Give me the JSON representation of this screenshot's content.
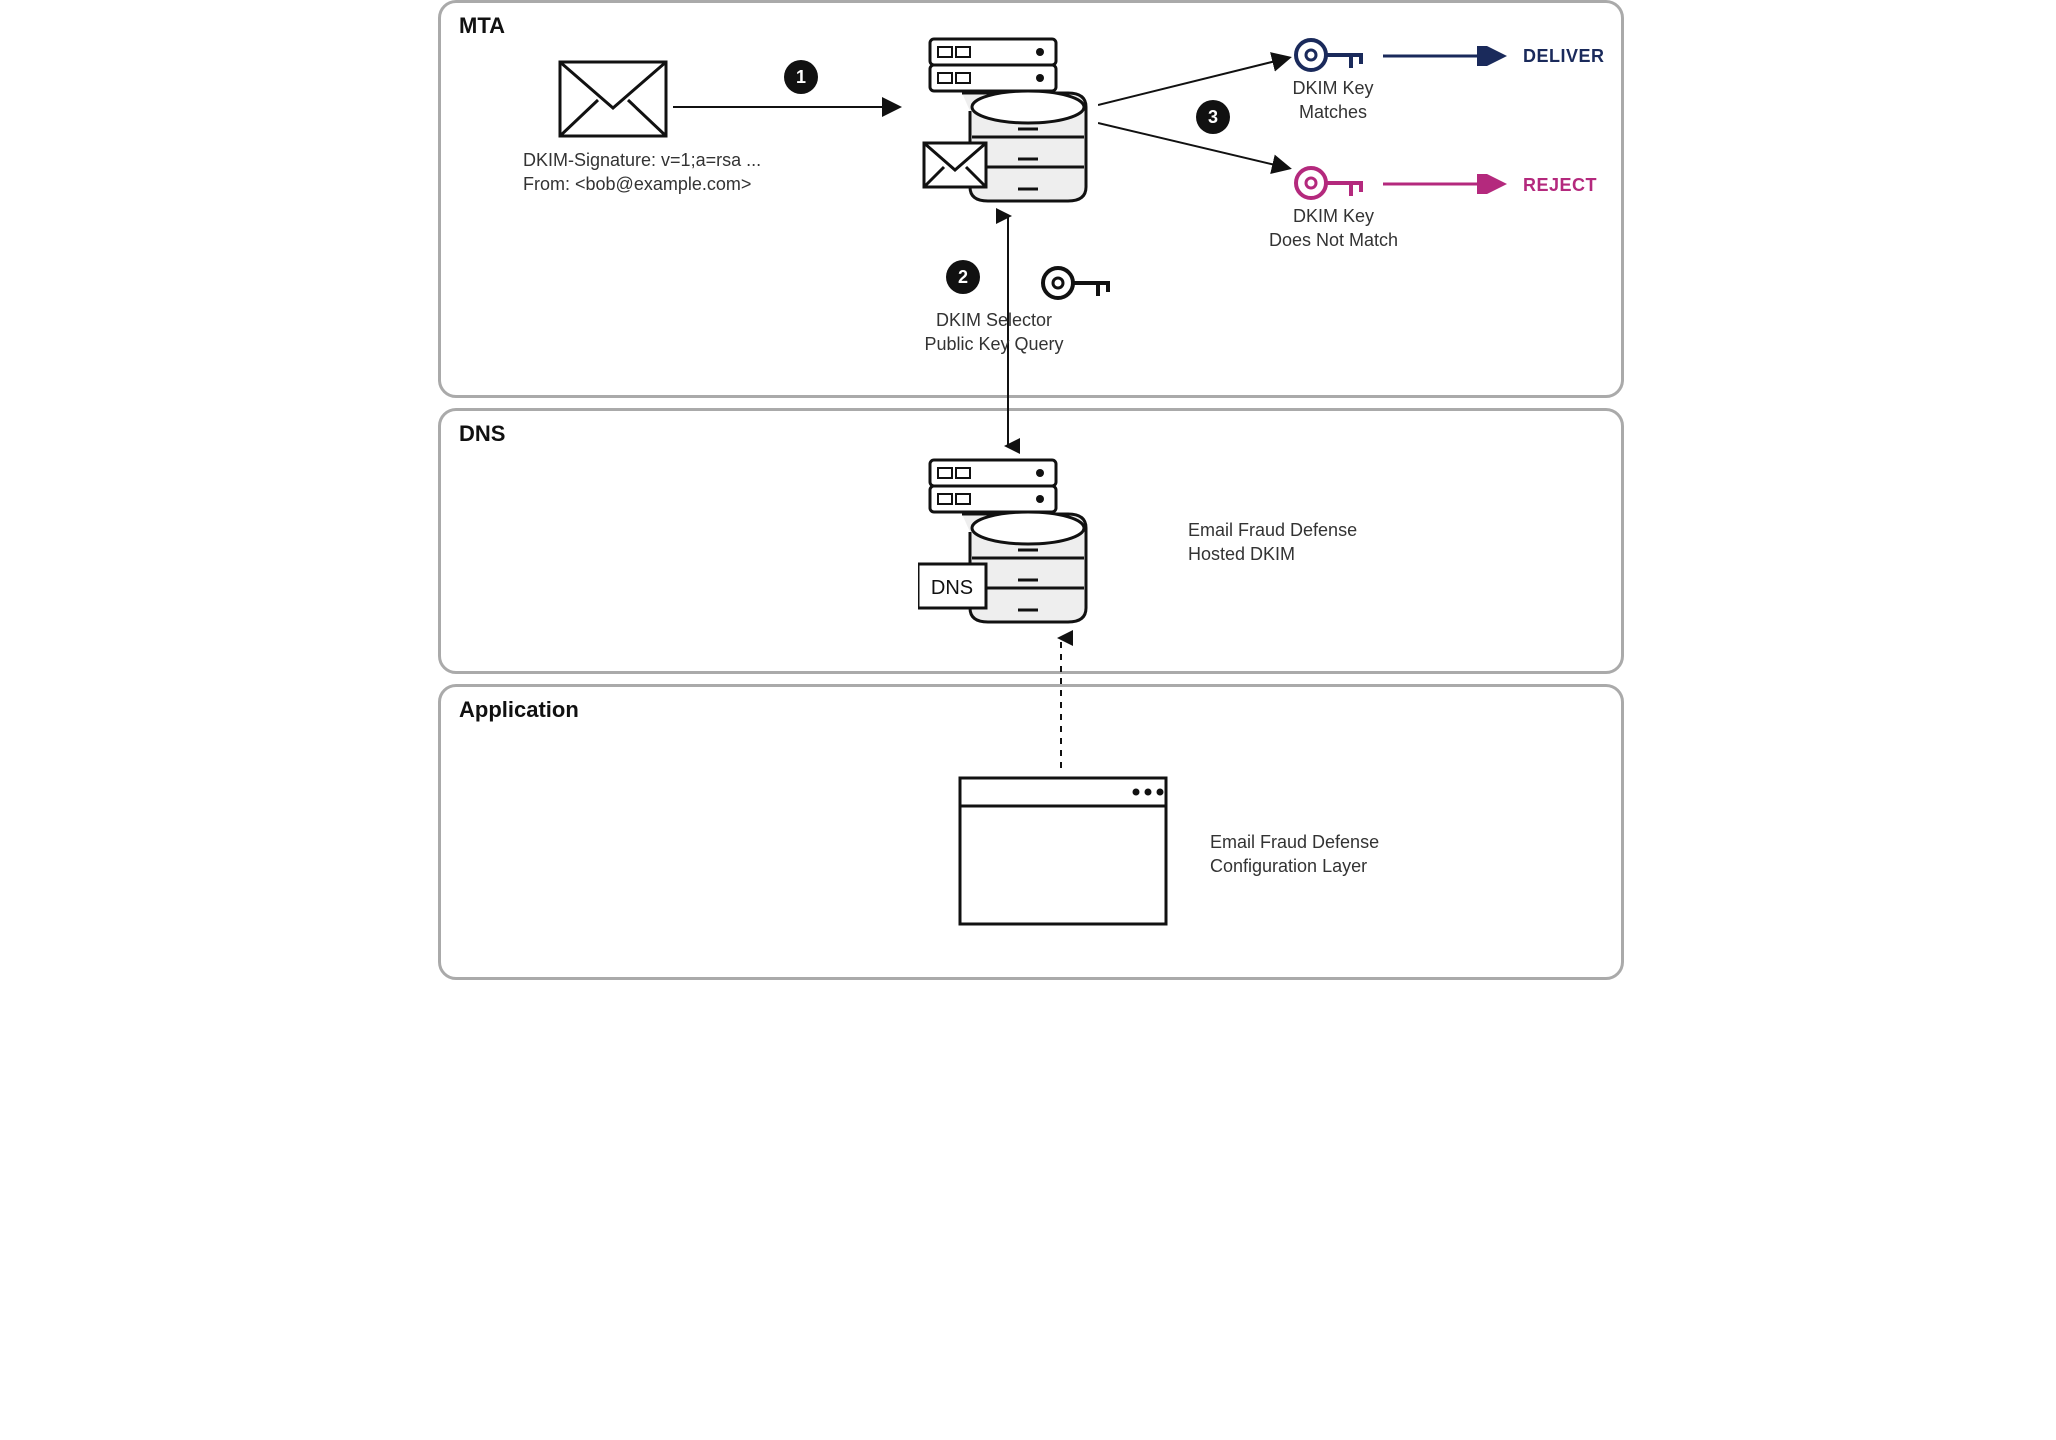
{
  "sections": {
    "mta": "MTA",
    "dns": "DNS",
    "application": "Application"
  },
  "email": {
    "line1": "DKIM-Signature: v=1;a=rsa ...",
    "line2": "From: <bob@example.com>"
  },
  "steps": {
    "s1": "1",
    "s2": "2",
    "s3": "3"
  },
  "labels": {
    "query": "DKIM Selector\nPublic Key Query",
    "match": "DKIM Key\nMatches",
    "nomatch": "DKIM Key\nDoes Not Match",
    "dns_service": "Email Fraud Defense\nHosted DKIM",
    "app_service": "Email Fraud Defense\nConfiguration Layer",
    "dns_tag": "DNS"
  },
  "verdicts": {
    "deliver": "DELIVER",
    "reject": "REJECT"
  }
}
